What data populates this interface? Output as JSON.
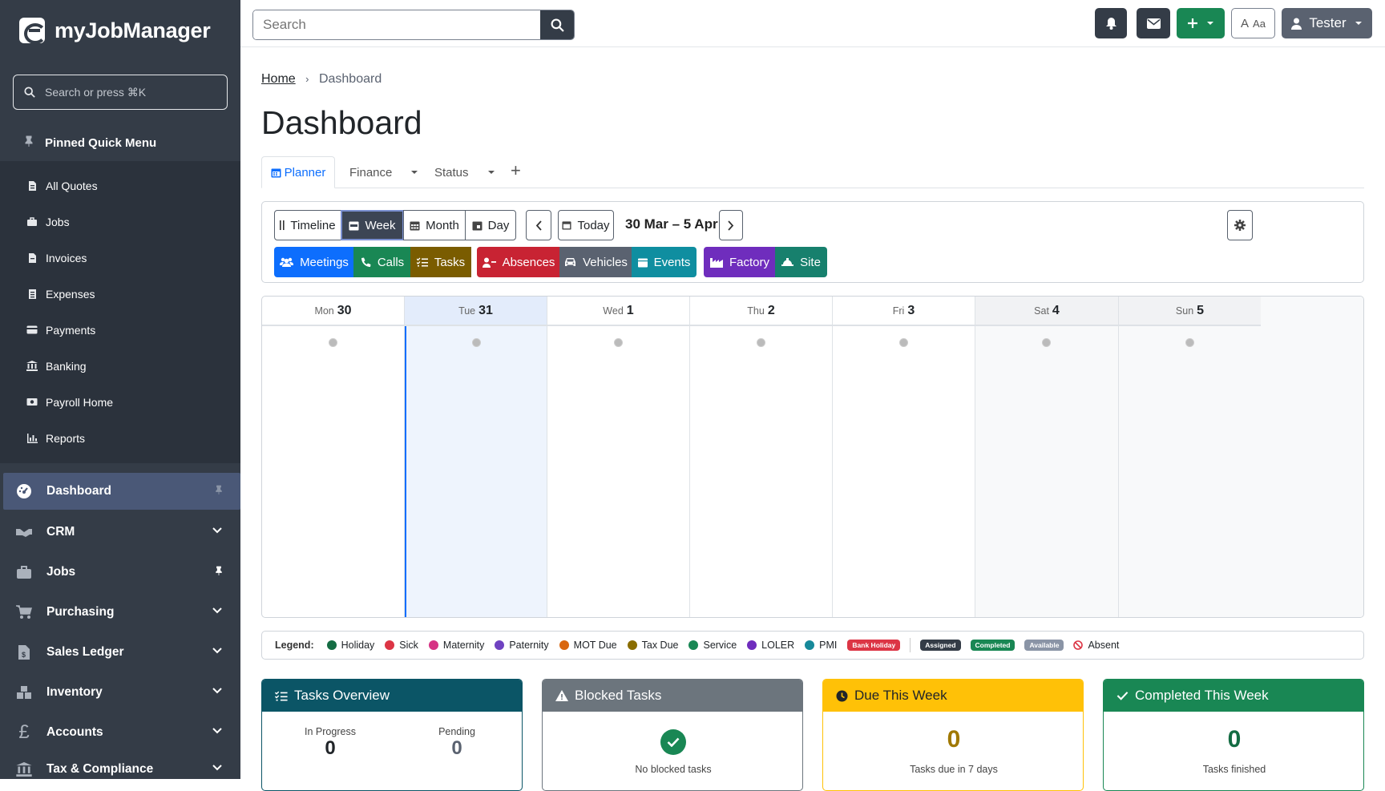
{
  "app": {
    "name": "myJobManager"
  },
  "sidebar": {
    "search_placeholder": "Search or press ⌘K",
    "pinned_title": "Pinned Quick Menu",
    "pinned_items": [
      {
        "label": "All Quotes",
        "icon": "file-icon"
      },
      {
        "label": "Jobs",
        "icon": "briefcase-icon"
      },
      {
        "label": "Invoices",
        "icon": "invoice-icon"
      },
      {
        "label": "Expenses",
        "icon": "receipt-icon"
      },
      {
        "label": "Payments",
        "icon": "card-icon"
      },
      {
        "label": "Banking",
        "icon": "bank-icon"
      },
      {
        "label": "Payroll Home",
        "icon": "money-icon"
      },
      {
        "label": "Reports",
        "icon": "chart-icon"
      }
    ],
    "nav": [
      {
        "label": "Dashboard",
        "icon": "gauge-icon",
        "active": true
      },
      {
        "label": "CRM",
        "icon": "handshake-icon"
      },
      {
        "label": "Jobs",
        "icon": "briefcase-icon"
      },
      {
        "label": "Purchasing",
        "icon": "cart-icon"
      },
      {
        "label": "Sales Ledger",
        "icon": "ledger-icon"
      },
      {
        "label": "Inventory",
        "icon": "boxes-icon"
      },
      {
        "label": "Accounts",
        "icon": "pound-icon"
      },
      {
        "label": "Tax & Compliance",
        "icon": "bank-icon"
      }
    ]
  },
  "topbar": {
    "search_placeholder": "Search",
    "font_label_a": "A",
    "font_label_aa": "Aa",
    "user": "Tester"
  },
  "breadcrumb": {
    "home": "Home",
    "current": "Dashboard"
  },
  "page": {
    "title": "Dashboard"
  },
  "tabs": {
    "planner": "Planner",
    "finance": "Finance",
    "status": "Status",
    "add": "+"
  },
  "view": {
    "timeline": "Timeline",
    "week": "Week",
    "month": "Month",
    "day": "Day",
    "today": "Today",
    "range": "30 Mar – 5 Apr",
    "selected": "Week"
  },
  "categories": [
    {
      "label": "Meetings",
      "color": "#0d6efd"
    },
    {
      "label": "Calls",
      "color": "#198754"
    },
    {
      "label": "Tasks",
      "color": "#7a5c00"
    },
    {
      "label": "Absences",
      "color": "#dc3545"
    },
    {
      "label": "Vehicles",
      "color": "#5a6270"
    },
    {
      "label": "Events",
      "color": "#0f8ea0"
    },
    {
      "label": "Factory",
      "color": "#6f2dbd"
    },
    {
      "label": "Site",
      "color": "#17806d"
    }
  ],
  "calendar": {
    "days": [
      {
        "dow": "Mon",
        "num": "30"
      },
      {
        "dow": "Tue",
        "num": "31",
        "today": true
      },
      {
        "dow": "Wed",
        "num": "1"
      },
      {
        "dow": "Thu",
        "num": "2"
      },
      {
        "dow": "Fri",
        "num": "3"
      },
      {
        "dow": "Sat",
        "num": "4",
        "weekend": true
      },
      {
        "dow": "Sun",
        "num": "5",
        "weekend": true
      }
    ]
  },
  "legend": {
    "title": "Legend:",
    "dots": [
      {
        "label": "Holiday",
        "color": "#146c43"
      },
      {
        "label": "Sick",
        "color": "#dc3545"
      },
      {
        "label": "Maternity",
        "color": "#d63384"
      },
      {
        "label": "Paternity",
        "color": "#6f42c1"
      },
      {
        "label": "MOT Due",
        "color": "#d9660f"
      },
      {
        "label": "Tax Due",
        "color": "#8a6d00"
      },
      {
        "label": "Service",
        "color": "#198754"
      },
      {
        "label": "LOLER",
        "color": "#6f2dbd"
      },
      {
        "label": "PMI",
        "color": "#17899a"
      }
    ],
    "bank_holiday": "Bank Holiday",
    "assigned": "Assigned",
    "completed": "Completed",
    "available": "Available",
    "absent": "Absent"
  },
  "cards": {
    "tasks_overview": {
      "title": "Tasks Overview",
      "in_progress_label": "In Progress",
      "in_progress": "0",
      "pending_label": "Pending",
      "pending": "0"
    },
    "blocked": {
      "title": "Blocked Tasks",
      "text": "No blocked tasks"
    },
    "due": {
      "title": "Due This Week",
      "value": "0",
      "text": "Tasks due in 7 days"
    },
    "completed": {
      "title": "Completed This Week",
      "value": "0",
      "text": "Tasks finished"
    }
  }
}
